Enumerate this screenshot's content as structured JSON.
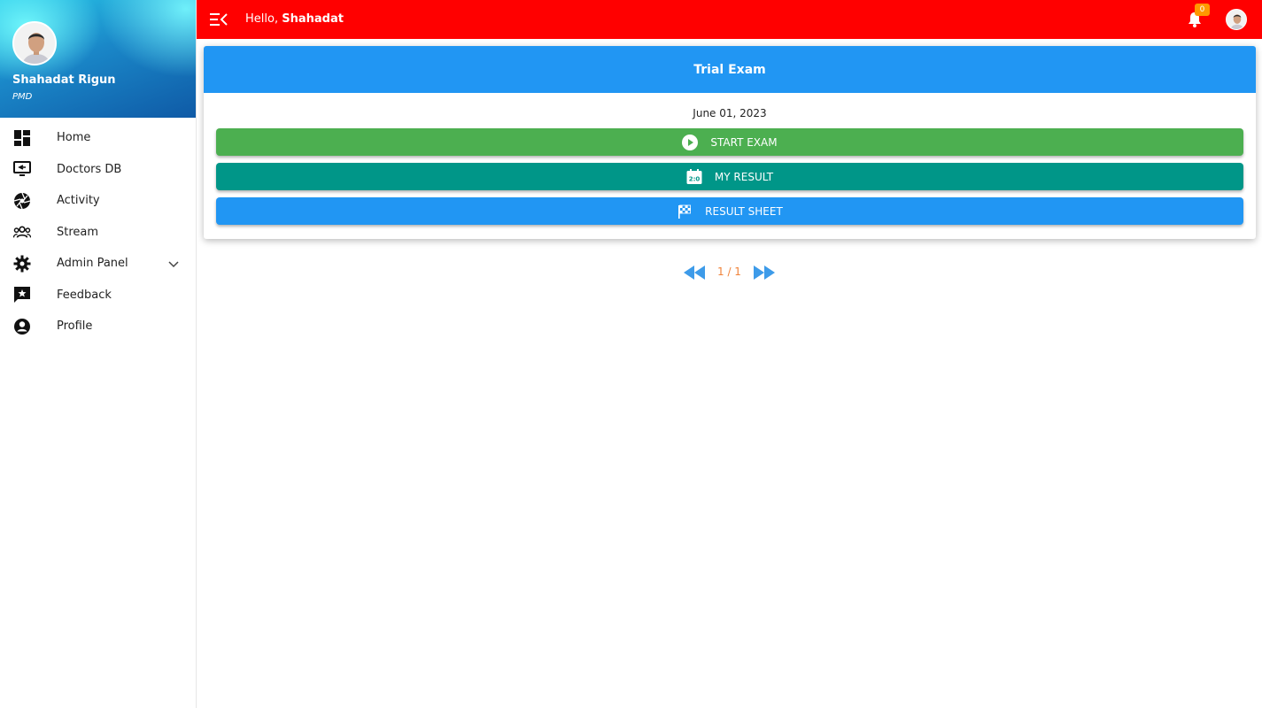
{
  "sidebar": {
    "profile": {
      "name": "Shahadat Rigun",
      "role": "PMD"
    },
    "items": [
      {
        "label": "Home",
        "icon": "dashboard-icon"
      },
      {
        "label": "Doctors DB",
        "icon": "monitor-icon"
      },
      {
        "label": "Activity",
        "icon": "aperture-icon"
      },
      {
        "label": "Stream",
        "icon": "group-icon"
      },
      {
        "label": "Admin Panel",
        "icon": "gear-icon"
      },
      {
        "label": "Feedback",
        "icon": "feedback-icon"
      },
      {
        "label": "Profile",
        "icon": "account-circle-icon"
      }
    ]
  },
  "topbar": {
    "greeting_prefix": "Hello, ",
    "greeting_name": "Shahadat",
    "notification_count": "0"
  },
  "card": {
    "title": "Trial Exam",
    "date": "June 01, 2023",
    "buttons": {
      "start": "START EXAM",
      "result": "MY RESULT",
      "sheet": "RESULT SHEET"
    }
  },
  "pager": {
    "text": "1 / 1"
  },
  "colors": {
    "topbar": "#ff0000",
    "header": "#2196f3",
    "start": "#4caf50",
    "result": "#009688",
    "sheet": "#2196f3",
    "badge": "#ff9800",
    "pager_text": "#f0833a"
  }
}
